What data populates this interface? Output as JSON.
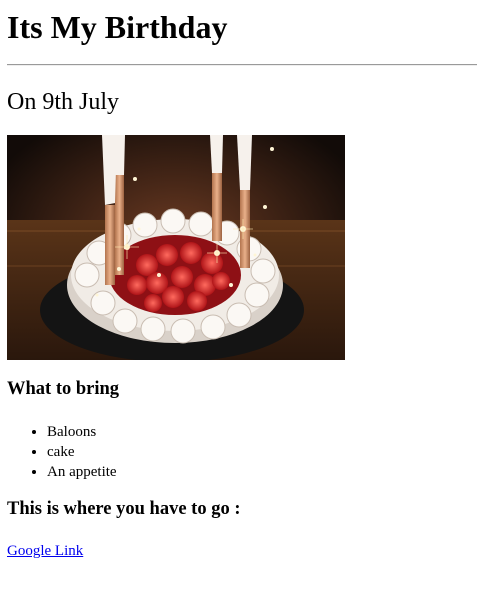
{
  "page": {
    "heading": "Its My Birthday",
    "date_heading": "On 9th July",
    "image": {
      "alt": "birthday-cake-photo"
    },
    "bring_heading": "What to bring",
    "bring_items": [
      "Baloons",
      "cake",
      "An appetite"
    ],
    "go_heading": "This is where you have to go :",
    "link_text": "Google Link"
  },
  "colors": {
    "link": "#0000ee",
    "rule": "#9a9a9a"
  }
}
